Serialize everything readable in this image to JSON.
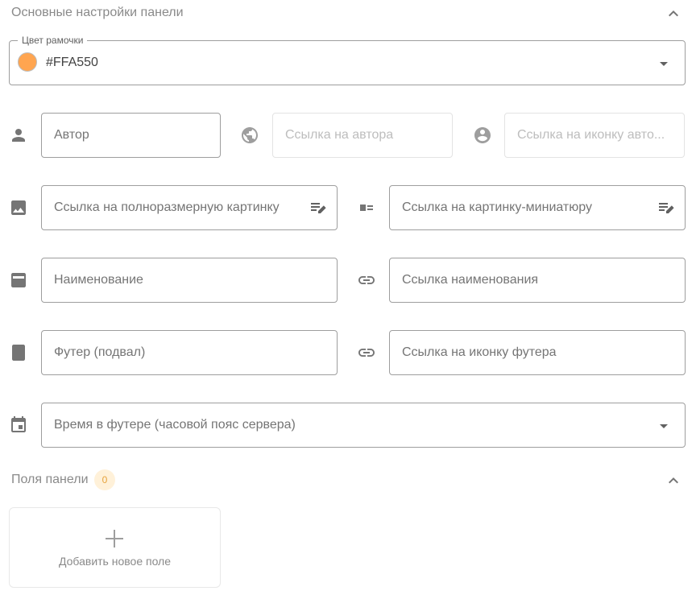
{
  "main_settings": {
    "title": "Основные настройки панели"
  },
  "border_color": {
    "label": "Цвет рамочки",
    "value": "#FFA550",
    "swatch_color": "#FFA550"
  },
  "fields": {
    "author": "Автор",
    "author_url": "Ссылка на автора",
    "author_icon_url": "Ссылка на иконку авто...",
    "image_url": "Ссылка на полноразмерную картинку",
    "thumbnail_url": "Ссылка на картинку-миниатюру",
    "title": "Наименование",
    "title_url": "Ссылка наименования",
    "footer": "Футер (подвал)",
    "footer_icon_url": "Ссылка на иконку футера",
    "footer_time": "Время в футере (часовой пояс сервера)"
  },
  "panel_fields": {
    "title": "Поля панели",
    "count": "0",
    "add_label": "Добавить новое поле"
  },
  "icons": {
    "collapse": "chevron-up-icon",
    "dropdown": "caret-down-icon",
    "author": "person-icon",
    "author_url": "globe-icon",
    "author_icon": "account-circle-icon",
    "image": "image-icon",
    "thumbnail": "featured-video-icon",
    "edit": "edit-note-icon",
    "title": "calendar-view-day-icon",
    "link": "link-icon",
    "footer": "book-icon",
    "time": "event-icon",
    "add": "plus-icon"
  },
  "colors": {
    "accent": "#FFA550",
    "badge_bg": "#fff1d9",
    "badge_text": "#e6a23c"
  }
}
